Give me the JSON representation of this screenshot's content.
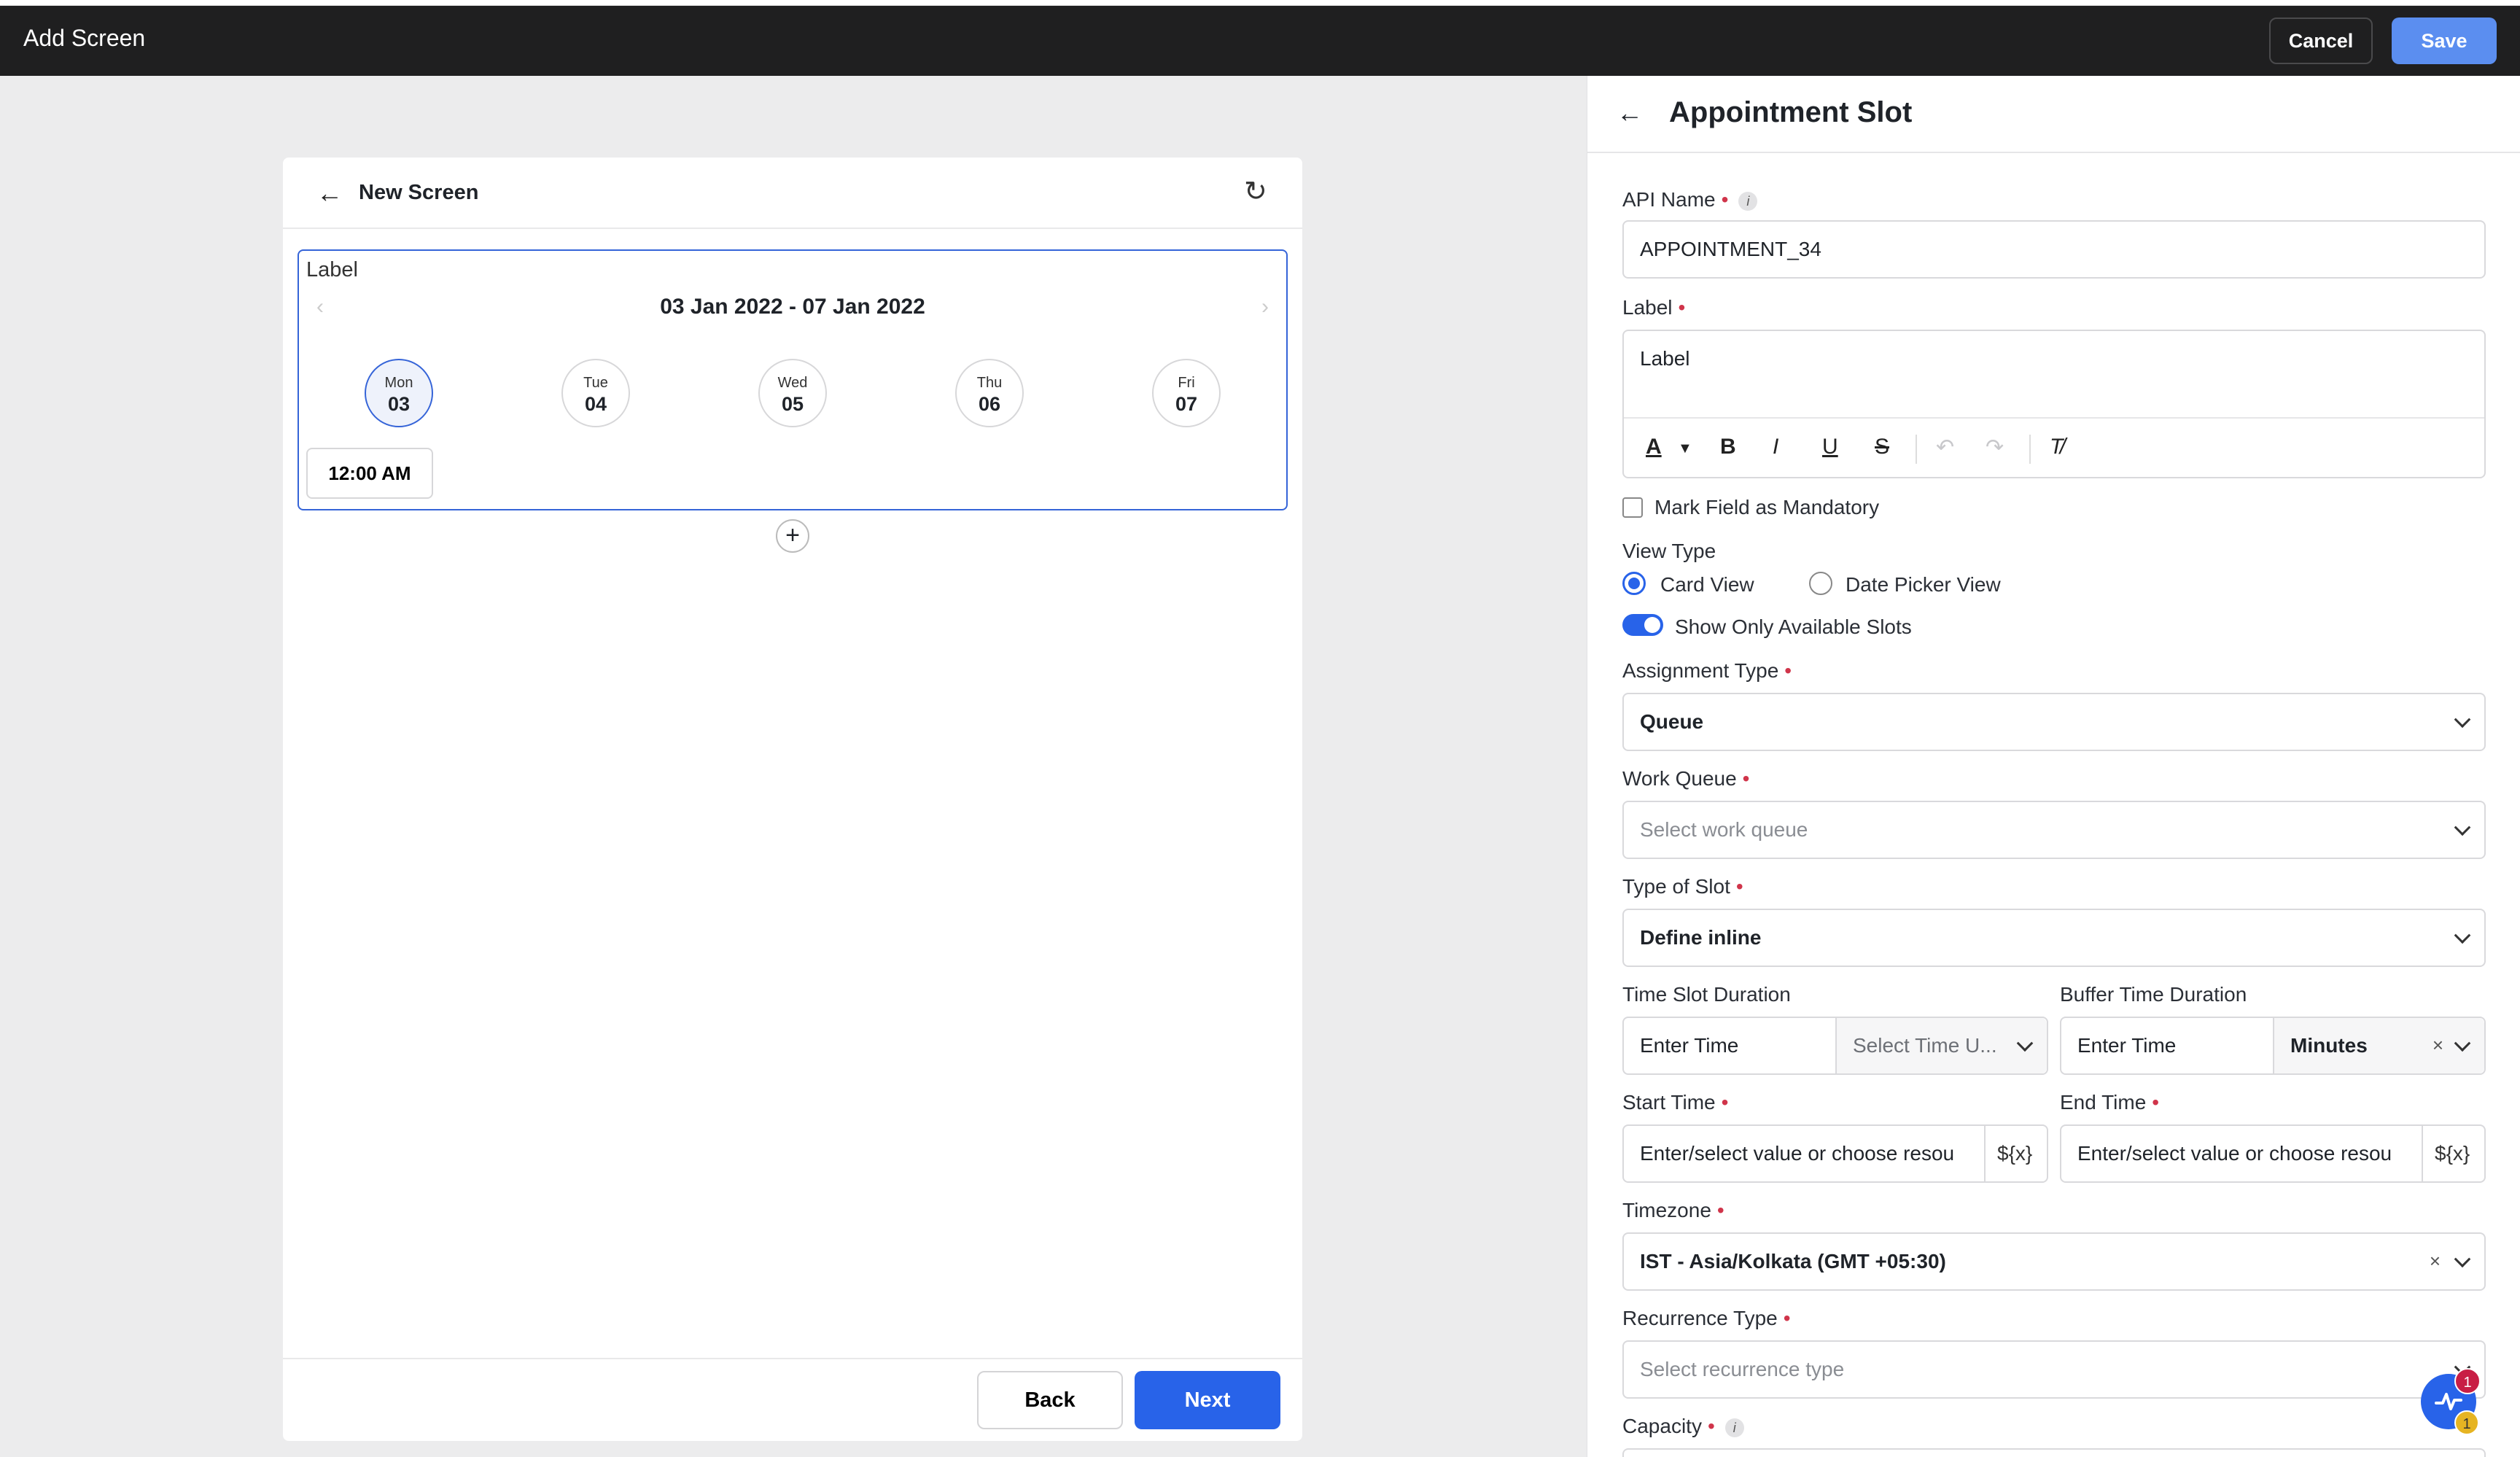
{
  "topbar": {
    "title": "Add Screen",
    "cancel_label": "Cancel",
    "save_label": "Save"
  },
  "canvas": {
    "screen_title": "New Screen",
    "widget": {
      "label": "Label",
      "date_range": "03 Jan 2022 - 07 Jan 2022",
      "days": [
        {
          "name": "Mon",
          "date": "03",
          "selected": true
        },
        {
          "name": "Tue",
          "date": "04"
        },
        {
          "name": "Wed",
          "date": "05"
        },
        {
          "name": "Thu",
          "date": "06"
        },
        {
          "name": "Fri",
          "date": "07"
        }
      ],
      "time_slot": "12:00 AM"
    },
    "add_glyph": "+",
    "back_label": "Back",
    "next_label": "Next"
  },
  "panel": {
    "title": "Appointment Slot",
    "api_name": {
      "label": "API Name",
      "value": "APPOINTMENT_34"
    },
    "label_field": {
      "label": "Label",
      "value": "Label"
    },
    "mandatory": {
      "label": "Mark Field as Mandatory"
    },
    "view_type": {
      "label": "View Type",
      "option_card": "Card View",
      "option_date_picker": "Date Picker View"
    },
    "show_available": {
      "label": "Show Only Available Slots"
    },
    "assignment_type": {
      "label": "Assignment Type",
      "value": "Queue"
    },
    "work_queue": {
      "label": "Work Queue",
      "placeholder": "Select work queue"
    },
    "type_of_slot": {
      "label": "Type of Slot",
      "value": "Define inline"
    },
    "time_slot_duration": {
      "label": "Time Slot Duration",
      "time_placeholder": "Enter Time",
      "unit_placeholder": "Select Time U..."
    },
    "buffer_time_duration": {
      "label": "Buffer Time Duration",
      "time_placeholder": "Enter Time",
      "unit_value": "Minutes"
    },
    "start_time": {
      "label": "Start Time",
      "placeholder": "Enter/select value or choose resou",
      "var_btn": "${x}"
    },
    "end_time": {
      "label": "End Time",
      "placeholder": "Enter/select value or choose resou",
      "var_btn": "${x}"
    },
    "timezone": {
      "label": "Timezone",
      "value": "IST - Asia/Kolkata (GMT +05:30)"
    },
    "recurrence_type": {
      "label": "Recurrence Type",
      "placeholder": "Select recurrence type"
    },
    "capacity": {
      "label": "Capacity"
    }
  },
  "fab": {
    "badge_top": "1",
    "badge_bottom": "1"
  },
  "colors": {
    "accent": "#2863e9",
    "required": "#d0344a",
    "topbar": "#1f1f20"
  }
}
